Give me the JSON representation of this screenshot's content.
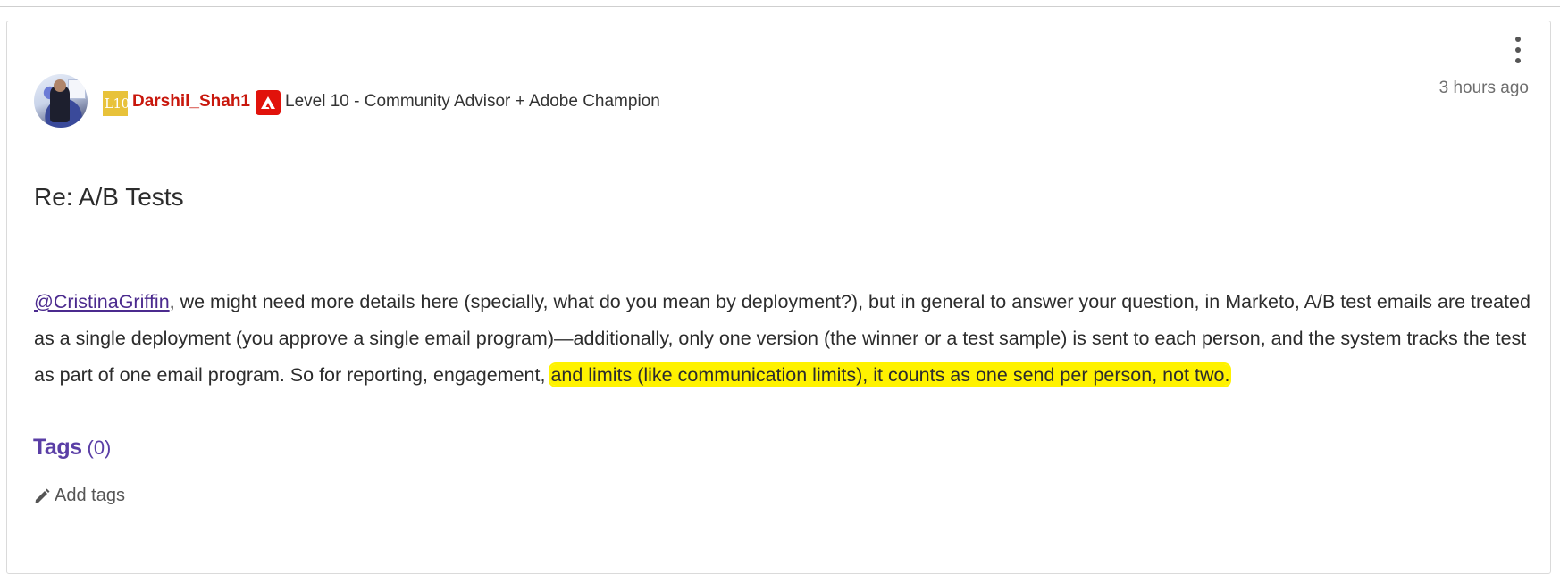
{
  "post": {
    "author": {
      "rank_badge": "L10",
      "username": "Darshil_Shah1",
      "rank_title": "Level 10 - Community Advisor + Adobe Champion"
    },
    "timestamp": "3 hours ago",
    "subject": "Re: A/B Tests",
    "body": {
      "mention": "@CristinaGriffin",
      "text_plain": ", we might need more details here (specially, what do you mean by deployment?), but in general to answer your question, in Marketo, A/B test emails are treated as a single deployment (you approve a single email program)—additionally, only one version (the winner or a test sample) is sent to each person, and the system tracks the test as part of one email program. So for reporting, engagement, ",
      "text_highlighted": "and limits (like communication limits), it counts as one send per person, not two."
    },
    "tags": {
      "title": "Tags",
      "count": "(0)",
      "add_label": "Add tags"
    }
  },
  "colors": {
    "username": "#c8170c",
    "rank_badge": "#e8c23a",
    "adobe_icon": "#e1120b",
    "mention": "#4b2a8e",
    "highlight": "#fff200",
    "tags": "#5a3ea6"
  },
  "icons": {
    "menu": "kebab-menu-icon",
    "adobe": "adobe-logo-icon",
    "edit": "pencil-icon"
  }
}
